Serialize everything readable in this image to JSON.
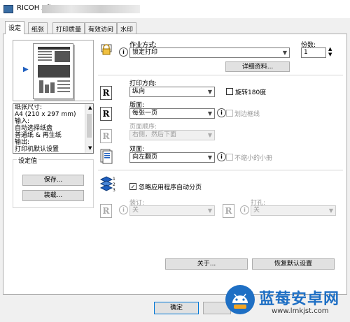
{
  "window": {
    "title": "RICOH Afic"
  },
  "tabs": [
    "设定",
    "纸张",
    "打印质量",
    "有效访问",
    "水印"
  ],
  "preview_info": {
    "lines": [
      "纸张尺寸:",
      " A4 (210 x 297 mm)",
      "输入:",
      " 自动选择纸盘",
      " 普通纸 & 再生纸",
      "输出:",
      " 打印机默认设置"
    ]
  },
  "preset_group": {
    "title": "设定值",
    "save_label": "保存...",
    "load_label": "装载..."
  },
  "job": {
    "label": "作业方式:",
    "value": "锁定打印",
    "details_label": "详细资料..."
  },
  "copies": {
    "label": "份数:",
    "value": "1"
  },
  "orientation": {
    "label": "打印方向:",
    "value": "纵向",
    "rotate_label": "旋转180度"
  },
  "layout": {
    "label": "版面:",
    "value": "每张一页",
    "border_label": "划边框线"
  },
  "page_order": {
    "label": "页面顺序:",
    "value": "右侧，然后下面"
  },
  "duplex": {
    "label": "双面:",
    "value": "向左翻页",
    "no_reduce_label": "不缩小的小册"
  },
  "collate": {
    "ignore_label": "忽略应用程序自动分页"
  },
  "staple": {
    "label": "装订:",
    "value": "关"
  },
  "punch": {
    "label": "打孔:",
    "value": "关"
  },
  "footer": {
    "about_label": "关于...",
    "restore_label": "恢复默认设置",
    "ok_label": "确定"
  },
  "watermark": {
    "brand": "蓝莓安卓网",
    "url": "www.lmkjst.com"
  },
  "colors": {
    "tab_border": "#adadad",
    "primary_border": "#0078d7",
    "brand_blue": "#1e6fc4"
  }
}
